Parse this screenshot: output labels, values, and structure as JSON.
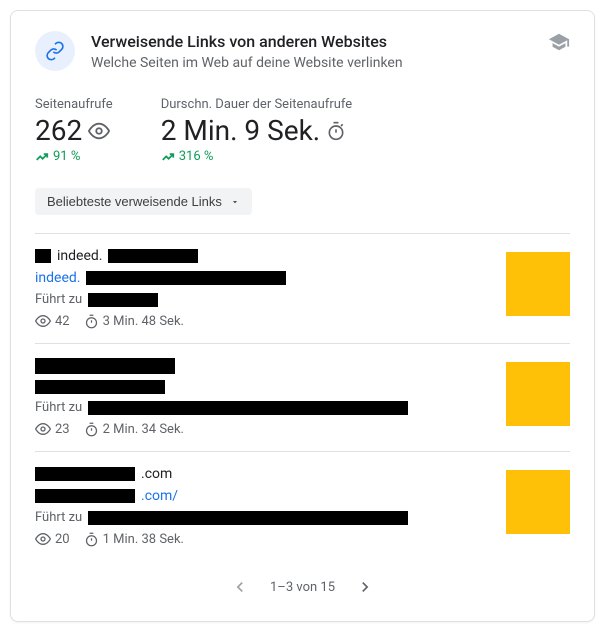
{
  "header": {
    "title": "Verweisende Links von anderen Websites",
    "subtitle": "Welche Seiten im Web auf deine Website verlinken"
  },
  "stats": {
    "views_label": "Seitenaufrufe",
    "views_value": "262",
    "views_change": "91 %",
    "duration_label": "Durschn. Dauer der Seitenaufrufe",
    "duration_value": "2 Min. 9 Sek.",
    "duration_change": "316 %"
  },
  "dropdown": {
    "label": "Beliebteste verweisende Links"
  },
  "items": [
    {
      "source_prefix": "indeed.",
      "link_prefix": "indeed.",
      "target_label": "Führt zu",
      "views": "42",
      "duration": "3 Min. 48 Sek."
    },
    {
      "source_prefix": "",
      "link_prefix": "",
      "target_label": "Führt zu",
      "views": "23",
      "duration": "2 Min. 34 Sek."
    },
    {
      "source_suffix": ".com",
      "link_suffix": ".com/",
      "target_label": "Führt zu",
      "views": "20",
      "duration": "1 Min. 38 Sek."
    }
  ],
  "pager": {
    "text": "1–3 von 15"
  }
}
